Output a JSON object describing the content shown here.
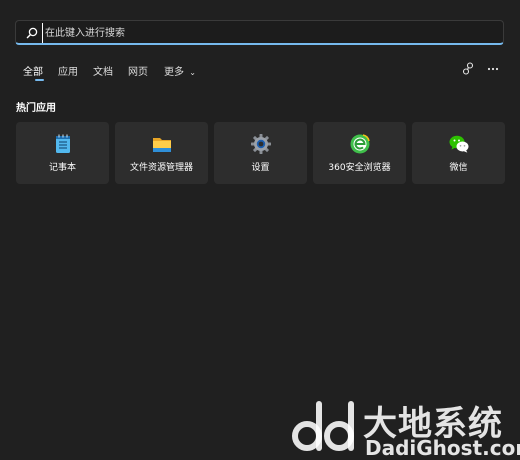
{
  "search": {
    "placeholder": "在此键入进行搜索",
    "value": ""
  },
  "tabs": [
    {
      "label": "全部",
      "active": true
    },
    {
      "label": "应用"
    },
    {
      "label": "文档"
    },
    {
      "label": "网页"
    },
    {
      "label": "更多"
    }
  ],
  "top_icons": {
    "share": "share-icon",
    "more": "more-icon"
  },
  "section": {
    "title": "热门应用"
  },
  "apps": [
    {
      "label": "记事本",
      "icon": "notepad-icon"
    },
    {
      "label": "文件资源管理器",
      "icon": "file-explorer-icon"
    },
    {
      "label": "设置",
      "icon": "settings-gear-icon"
    },
    {
      "label": "360安全浏览器",
      "icon": "360-browser-icon"
    },
    {
      "label": "微信",
      "icon": "wechat-icon"
    }
  ],
  "watermark": {
    "brand": "大地系统",
    "url": "DadiGhost.com"
  },
  "colors": {
    "background": "#202020",
    "tile": "#2d2d2d",
    "accent": "#76b9ed"
  }
}
